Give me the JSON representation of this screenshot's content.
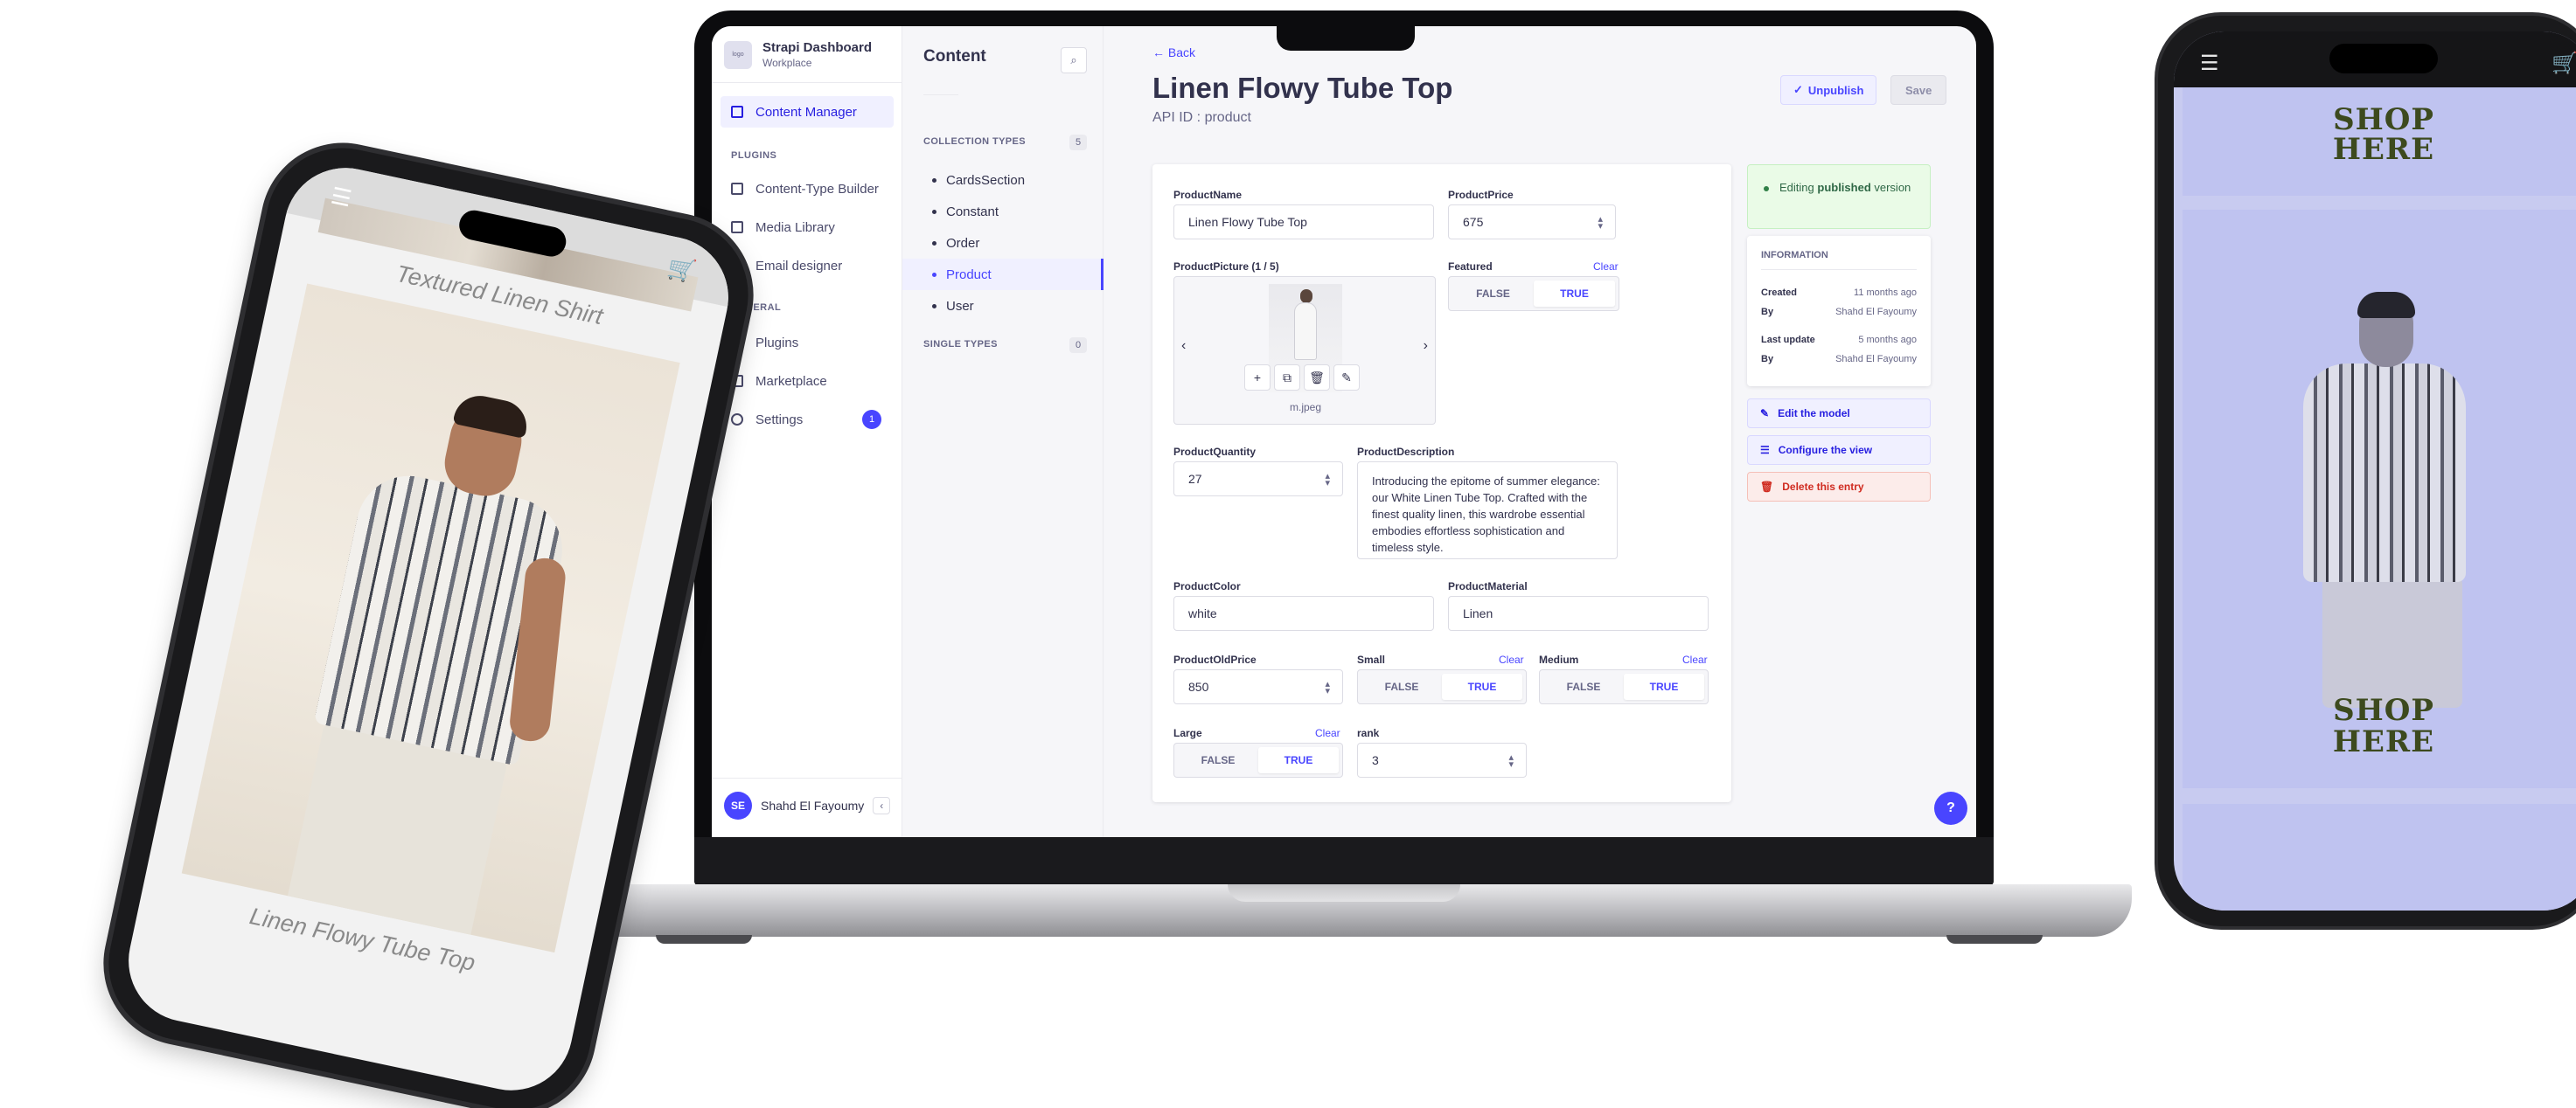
{
  "strapi": {
    "brand": {
      "logo": "logo",
      "title": "Strapi Dashboard",
      "subtitle": "Workplace"
    },
    "nav": {
      "content_manager": "Content Manager",
      "plugins_section": "PLUGINS",
      "content_type_builder": "Content-Type Builder",
      "media_library": "Media Library",
      "email_designer": "Email designer",
      "general_section": "GENERAL",
      "plugins": "Plugins",
      "marketplace": "Marketplace",
      "settings": "Settings",
      "settings_badge": "1"
    },
    "user": {
      "initials": "SE",
      "name": "Shahd El Fayoumy"
    },
    "sub_nav": {
      "title": "Content",
      "collection_section": "COLLECTION TYPES",
      "collection_count": "5",
      "items": [
        "CardsSection",
        "Constant",
        "Order",
        "Product",
        "User"
      ],
      "single_section": "SINGLE TYPES",
      "single_count": "0"
    },
    "header": {
      "back": "Back",
      "title": "Linen Flowy Tube Top",
      "api_id": "API ID : product",
      "unpublish": "Unpublish",
      "save": "Save"
    },
    "form": {
      "product_name_label": "ProductName",
      "product_name": "Linen Flowy Tube Top",
      "product_price_label": "ProductPrice",
      "product_price": "675",
      "product_picture_label": "ProductPicture (1 / 5)",
      "media_filename": "m.jpeg",
      "featured_label": "Featured",
      "clear": "Clear",
      "false": "FALSE",
      "true": "TRUE",
      "quantity_label": "ProductQuantity",
      "quantity": "27",
      "description_label": "ProductDescription",
      "description": "Introducing the epitome of summer elegance: our White Linen Tube Top. Crafted with the finest quality linen, this wardrobe essential embodies effortless sophistication and timeless style.",
      "color_label": "ProductColor",
      "color": "white",
      "material_label": "ProductMaterial",
      "material": "Linen",
      "old_price_label": "ProductOldPrice",
      "old_price": "850",
      "small_label": "Small",
      "medium_label": "Medium",
      "large_label": "Large",
      "rank_label": "rank",
      "rank": "3"
    },
    "sidebar": {
      "status_prefix": "Editing ",
      "status_bold": "published",
      "status_suffix": " version",
      "info_title": "INFORMATION",
      "created_label": "Created",
      "created_value": "11 months ago",
      "by_label": "By",
      "created_by": "Shahd El Fayoumy",
      "updated_label": "Last update",
      "updated_value": "5 months ago",
      "updated_by": "Shahd El Fayoumy",
      "edit_model": "Edit the model",
      "configure_view": "Configure the view",
      "delete_entry": "Delete this entry",
      "help": "?"
    },
    "colors": {
      "accent": "#4945ff",
      "status_green": "#eafbe7",
      "danger": "#d02b20"
    }
  },
  "phone_left": {
    "product_top": "Textured Linen Shirt",
    "product_bottom": "Linen Flowy Tube Top",
    "menu_icon": "☰",
    "cart_icon": "🛒"
  },
  "phone_right": {
    "banner_line1": "SHOP",
    "banner_line2": "HERE",
    "menu_icon": "☰",
    "cart_icon": "🛒",
    "background": "#bfc3f0"
  }
}
